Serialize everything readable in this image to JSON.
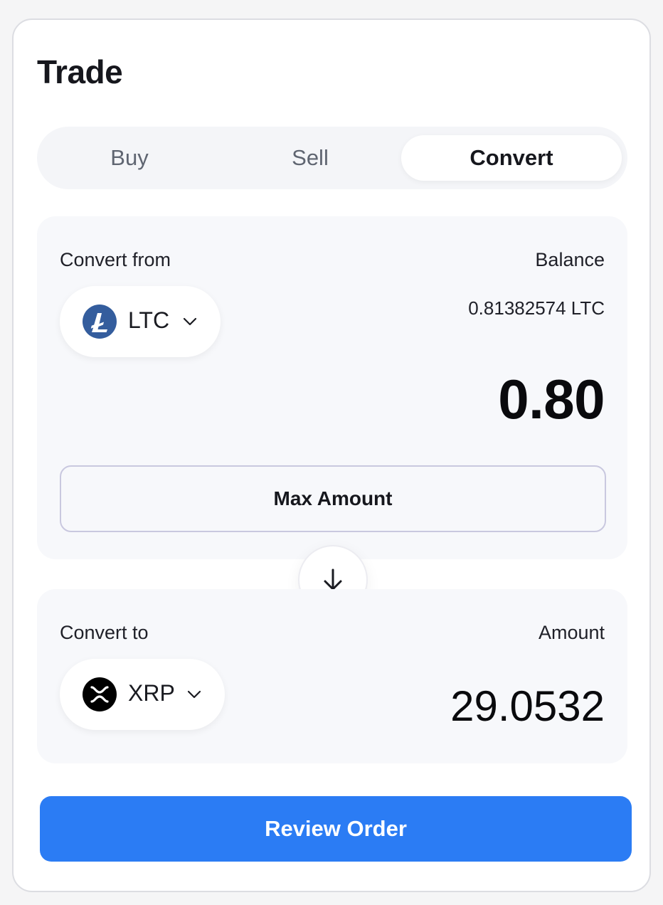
{
  "header": {
    "title": "Trade"
  },
  "tabs": [
    {
      "label": "Buy",
      "active": false
    },
    {
      "label": "Sell",
      "active": false
    },
    {
      "label": "Convert",
      "active": true
    }
  ],
  "from": {
    "label": "Convert from",
    "balance_label": "Balance",
    "coin": {
      "symbol": "LTC",
      "icon": "litecoin-icon",
      "color": "#345d9d"
    },
    "balance": "0.81382574 LTC",
    "amount": "0.80",
    "max_label": "Max Amount"
  },
  "swap": {
    "icon": "arrow-down-icon"
  },
  "to": {
    "label": "Convert to",
    "amount_label": "Amount",
    "coin": {
      "symbol": "XRP",
      "icon": "xrp-icon",
      "color": "#000000"
    },
    "amount": "29.0532"
  },
  "action": {
    "review_label": "Review Order",
    "color": "#2b7cf4"
  }
}
